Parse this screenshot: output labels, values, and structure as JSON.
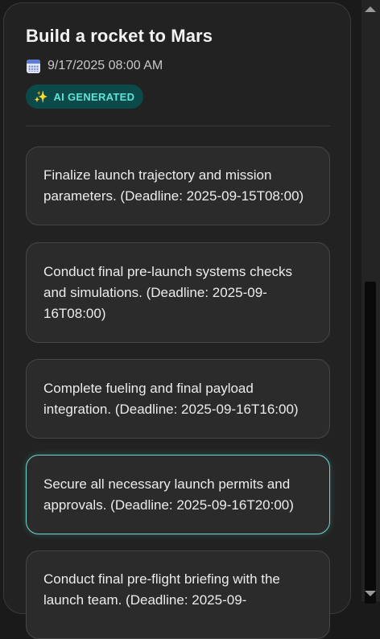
{
  "header": {
    "title": "Build a rocket to Mars",
    "date": "9/17/2025 08:00 AM",
    "date_icon": "calendar-icon",
    "badge_icon": "sparkles-icon",
    "badge_label": "AI GENERATED"
  },
  "tasks": [
    {
      "text": "Finalize launch trajectory and mission parameters. (Deadline: 2025-09-15T08:00)"
    },
    {
      "text": "Conduct final pre-launch systems checks and simulations. (Deadline: 2025-09-16T08:00)"
    },
    {
      "text": "Complete fueling and final payload integration. (Deadline: 2025-09-16T16:00)"
    },
    {
      "text": "Secure all necessary launch permits and approvals. (Deadline: 2025-09-16T20:00)",
      "selected": true
    },
    {
      "text": "Conduct final pre-flight briefing with the launch team. (Deadline: 2025-09-"
    }
  ],
  "colors": {
    "accent": "#5fe3d8",
    "badge_background": "#0c4a4a",
    "card_background": "#2b2b2b",
    "panel_background": "#222222",
    "selected_border": "#6fd6d0"
  }
}
